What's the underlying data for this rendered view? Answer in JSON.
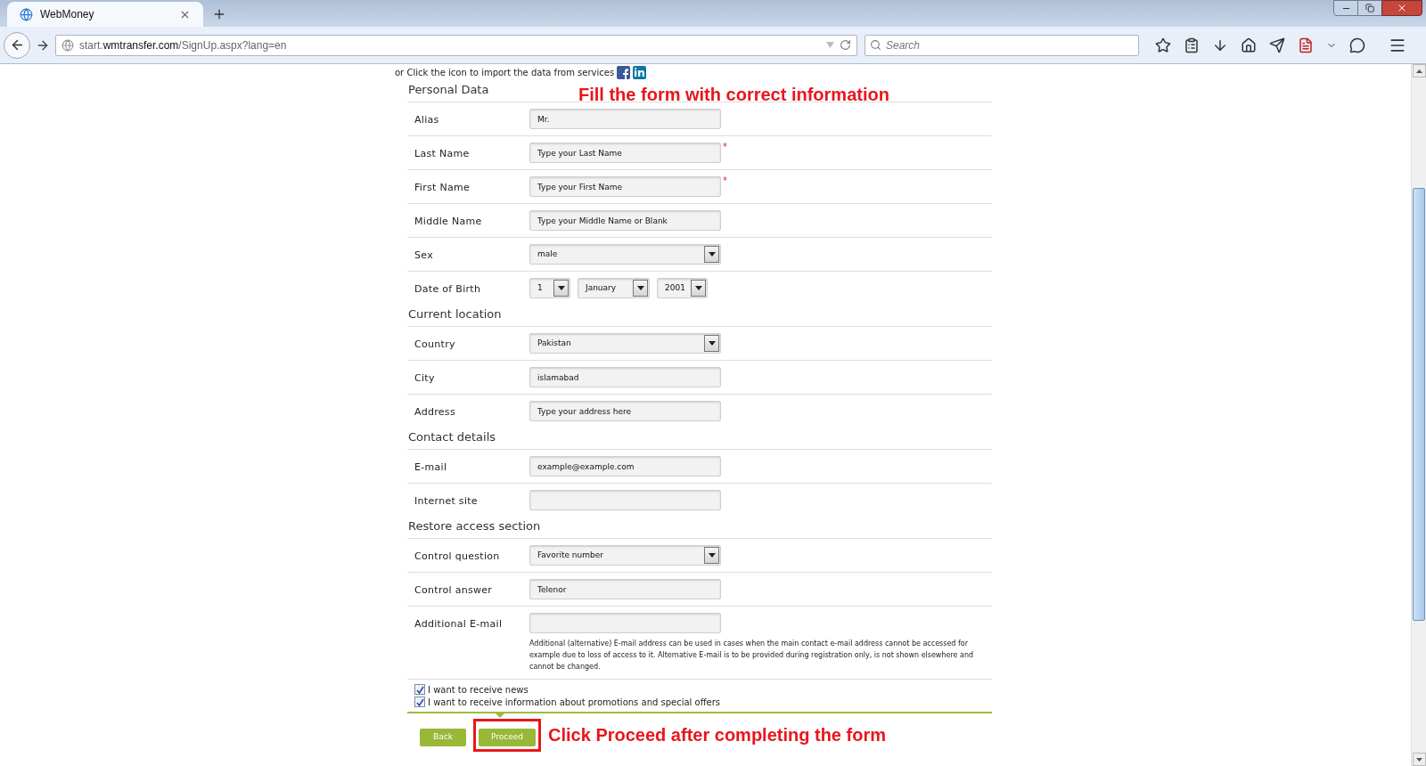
{
  "browser": {
    "tab": {
      "title": "WebMoney",
      "selected": true
    },
    "url": {
      "prefix": "start.",
      "domain": "wmtransfer.com",
      "path": "/SignUp.aspx?lang=en"
    },
    "search": {
      "placeholder": "Search"
    }
  },
  "required_symbol": "*",
  "import_text": "or Click the icon to import the data from services",
  "sections": [
    {
      "title": "Personal Data",
      "annotation": "Fill the form with correct information",
      "fields": [
        {
          "label": "Alias",
          "kind": "text",
          "value": "Mr.",
          "required": false
        },
        {
          "label": "Last Name",
          "kind": "text",
          "value": "Type your Last Name",
          "required": true
        },
        {
          "label": "First Name",
          "kind": "text",
          "value": "Type your First Name",
          "required": true
        },
        {
          "label": "Middle Name",
          "kind": "text",
          "value": "Type your Middle Name or Blank",
          "required": false
        },
        {
          "label": "Sex",
          "kind": "select",
          "value": "male",
          "required": false
        },
        {
          "label": "Date of Birth",
          "kind": "date",
          "parts": [
            "1",
            "January",
            "2001"
          ],
          "required": false
        }
      ]
    },
    {
      "title": "Current location",
      "fields": [
        {
          "label": "Country",
          "kind": "select",
          "value": "Pakistan",
          "required": false
        },
        {
          "label": "City",
          "kind": "text",
          "value": "islamabad",
          "required": false
        },
        {
          "label": "Address",
          "kind": "text",
          "value": "Type your address here",
          "required": false
        }
      ]
    },
    {
      "title": "Contact details",
      "fields": [
        {
          "label": "E-mail",
          "kind": "text",
          "value": "example@example.com",
          "required": false
        },
        {
          "label": "Internet site",
          "kind": "text",
          "required": false
        }
      ]
    },
    {
      "title": "Restore access section",
      "fields": [
        {
          "label": "Control question",
          "kind": "select",
          "value": "Favorite number",
          "required": false
        },
        {
          "label": "Control answer",
          "kind": "text",
          "value": "Telenor",
          "required": false
        },
        {
          "label": "Additional E-mail",
          "kind": "text",
          "required": false,
          "note": "Additional (alternative) E-mail address can be used in cases when the main contact e-mail address cannot be accessed for example due to loss of access to it. Alternative E-mail is to be provided during registration only, is not shown elsewhere and cannot be changed."
        }
      ]
    }
  ],
  "checkboxes": [
    {
      "label": "I want to receive news",
      "checked": true
    },
    {
      "label": "I want to receive information about promotions and special offers",
      "checked": true
    }
  ],
  "buttons": [
    {
      "label": "Back",
      "highlighted": false
    },
    {
      "label": "Proceed",
      "highlighted": true
    }
  ],
  "bottom_annotation": "Click Proceed after completing the form"
}
